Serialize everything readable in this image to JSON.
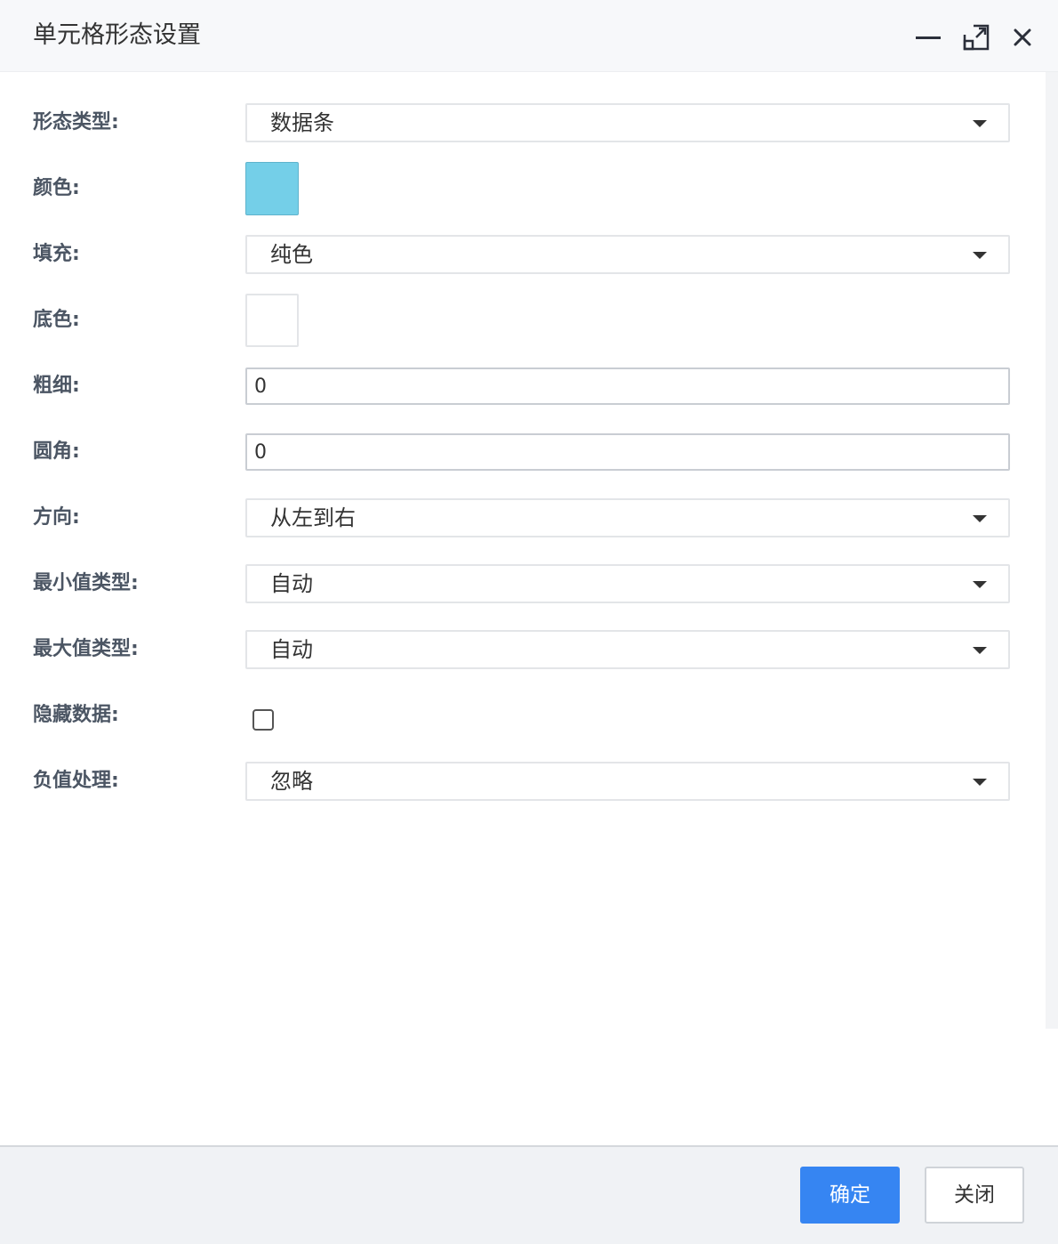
{
  "dialog": {
    "title": "单元格形态设置"
  },
  "window_controls": [
    "minimize-icon",
    "maximize-icon",
    "close-icon"
  ],
  "form": {
    "shape_type": {
      "label": "形态类型:",
      "value": "数据条"
    },
    "color": {
      "label": "颜色:",
      "value": "#74cfe8"
    },
    "fill": {
      "label": "填充:",
      "value": "纯色"
    },
    "base_color": {
      "label": "底色:",
      "value": "#ffffff"
    },
    "thickness": {
      "label": "粗细:",
      "value": "0"
    },
    "radius": {
      "label": "圆角:",
      "value": "0"
    },
    "direction": {
      "label": "方向:",
      "value": "从左到右"
    },
    "min_type": {
      "label": "最小值类型:",
      "value": "自动"
    },
    "max_type": {
      "label": "最大值类型:",
      "value": "自动"
    },
    "hide_data": {
      "label": "隐藏数据:",
      "checked": false
    },
    "negative": {
      "label": "负值处理:",
      "value": "忽略"
    }
  },
  "footer": {
    "ok_label": "确定",
    "close_label": "关闭"
  },
  "colors": {
    "accent": "#3685f2",
    "swatch": "#74cfe8"
  }
}
